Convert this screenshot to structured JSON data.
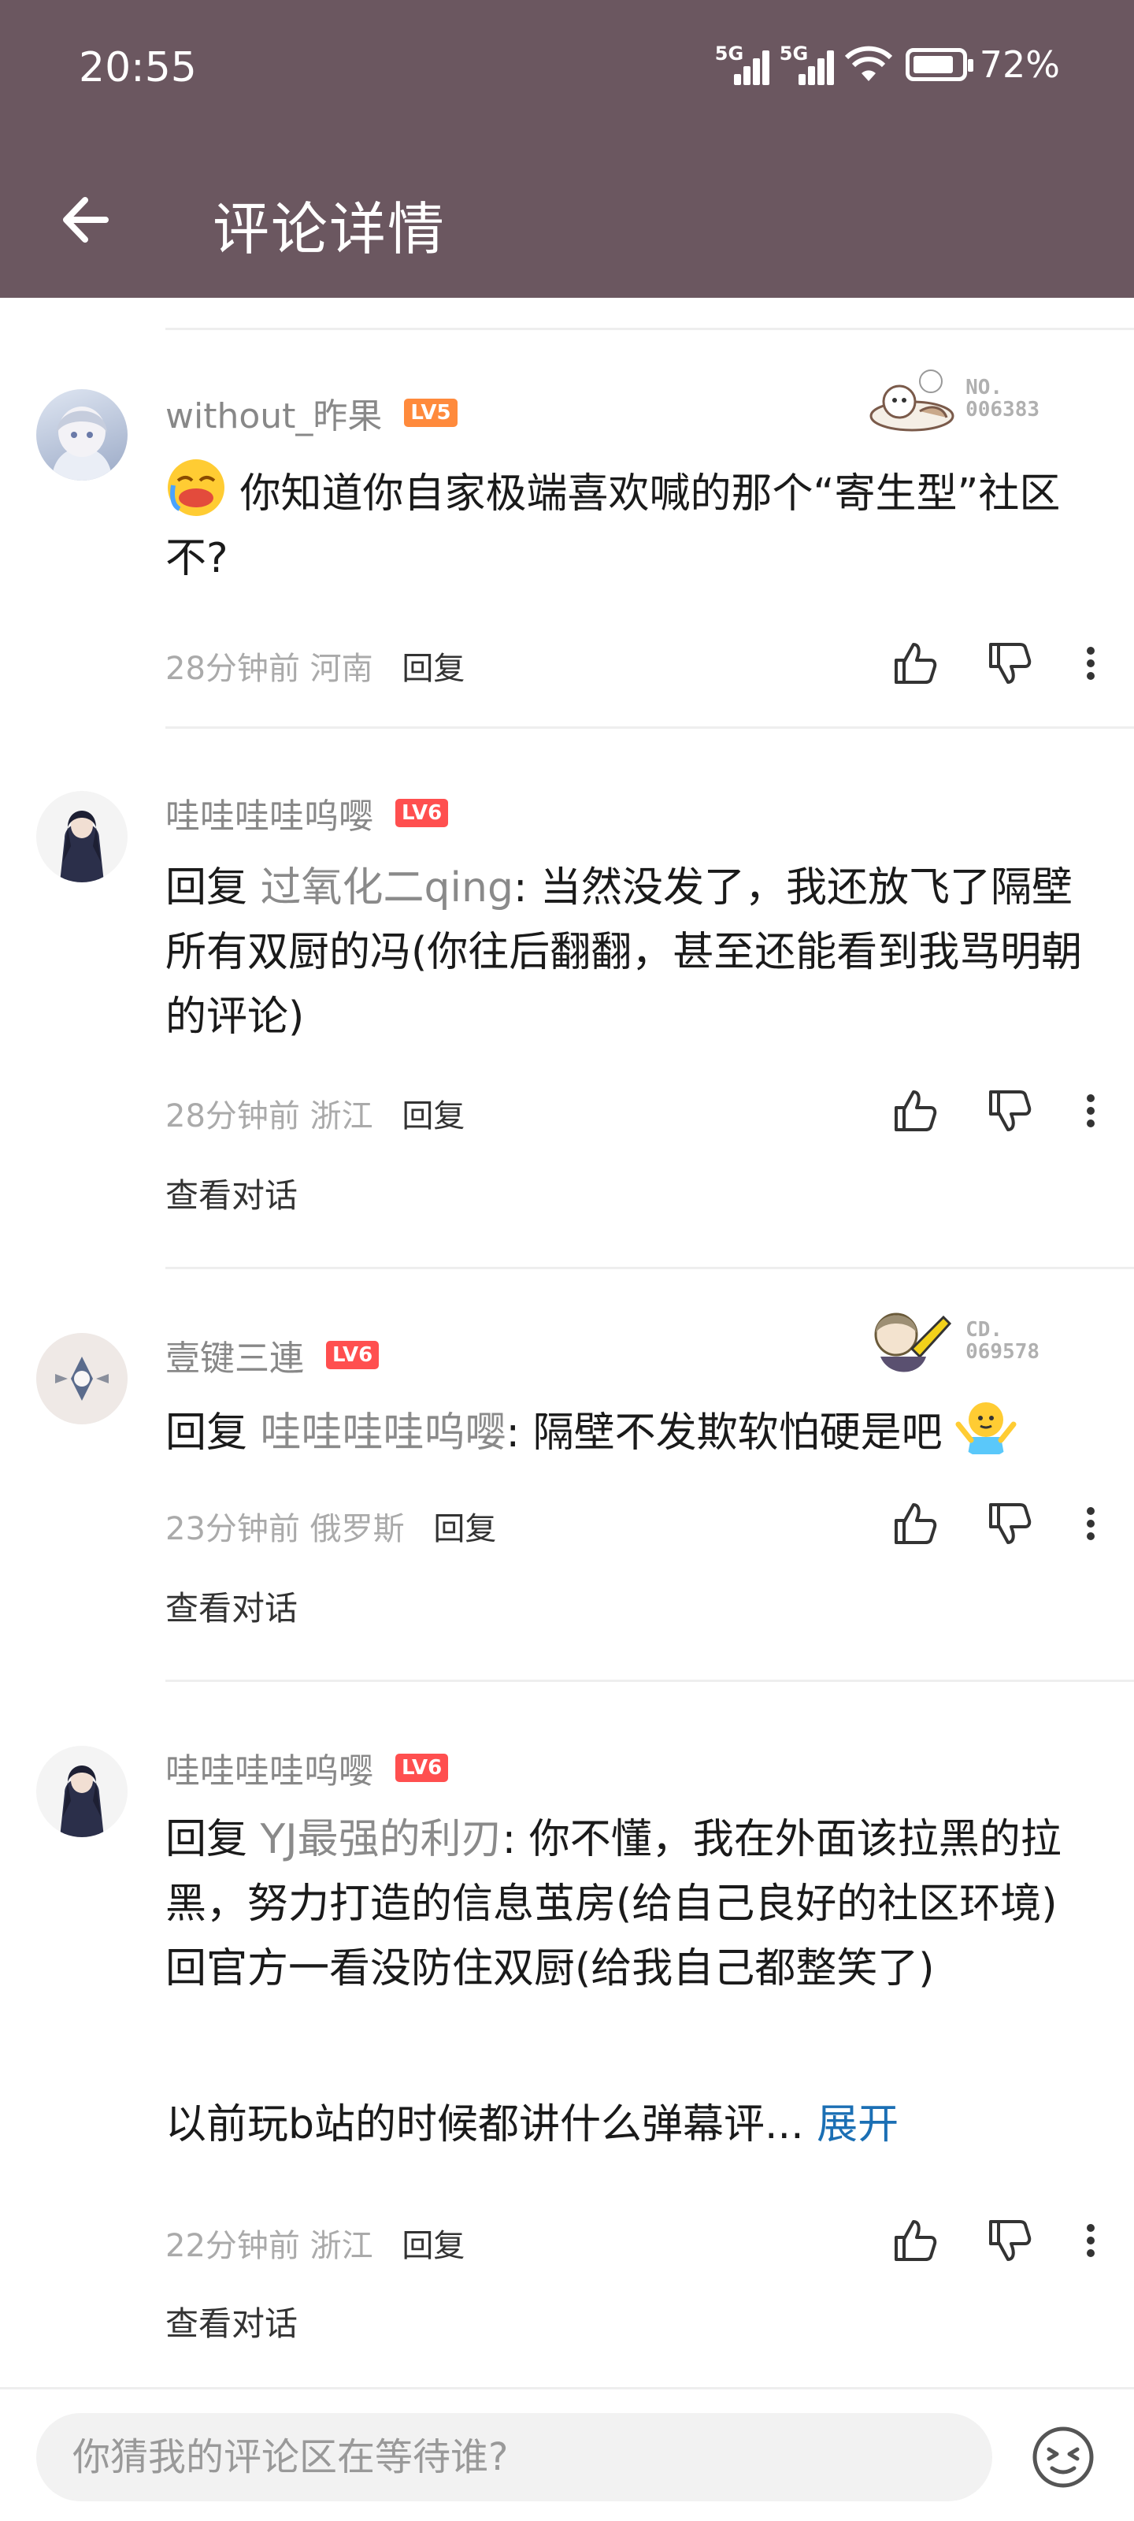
{
  "status_bar": {
    "time": "20:55",
    "sim1": "5G",
    "sim2": "5G",
    "battery": "72%",
    "battery_level": 0.72
  },
  "header": {
    "title": "评论详情",
    "back_icon": "arrow-left-icon"
  },
  "colors": {
    "header_bg": "#6b5760",
    "lv5": "#ff8a3c",
    "lv6": "#ff4f4f",
    "link": "#1b6fb4"
  },
  "comments": [
    {
      "username": "without_昨果",
      "level": "LV5",
      "badge_text": "NO.\n006383",
      "emoji": "crying-emoji",
      "text": "你知道你自家极端喜欢喊的那个“寄生型”社区不?",
      "time": "28分钟前",
      "location": "河南",
      "reply_label": "回复"
    },
    {
      "username": "哇哇哇哇呜嘤",
      "level": "LV6",
      "reply_prefix": "回复 ",
      "mention": "过氧化二qing",
      "text": ": 当然没发了，我还放飞了隔壁所有双厨的冯(你往后翻翻，甚至还能看到我骂明朝的评论)",
      "time": "28分钟前",
      "location": "浙江",
      "reply_label": "回复",
      "view_conversation": "查看对话"
    },
    {
      "username": "壹键三連",
      "level": "LV6",
      "badge_text": "CD.\n069578",
      "reply_prefix": "回复 ",
      "mention": "哇哇哇哇呜嘤",
      "text": ": 隔壁不发欺软怕硬是吧",
      "emoji": "shrug-emoji",
      "time": "23分钟前",
      "location": "俄罗斯",
      "reply_label": "回复",
      "view_conversation": "查看对话"
    },
    {
      "username": "哇哇哇哇呜嘤",
      "level": "LV6",
      "reply_prefix": "回复 ",
      "mention": "YJ最强的利刃",
      "text": ": 你不懂，我在外面该拉黑的拉黑，努力打造的信息茧房(给自己良好的社区环境)回官方一看没防住双厨(给我自己都整笑了)",
      "text2": "以前玩b站的时候都讲什么弹幕评...",
      "expand_label": "展开",
      "time": "22分钟前",
      "location": "浙江",
      "reply_label": "回复",
      "view_conversation": "查看对话"
    }
  ],
  "input": {
    "placeholder": "你猜我的评论区在等待谁?",
    "emoji_icon": "emoji-face-icon"
  }
}
